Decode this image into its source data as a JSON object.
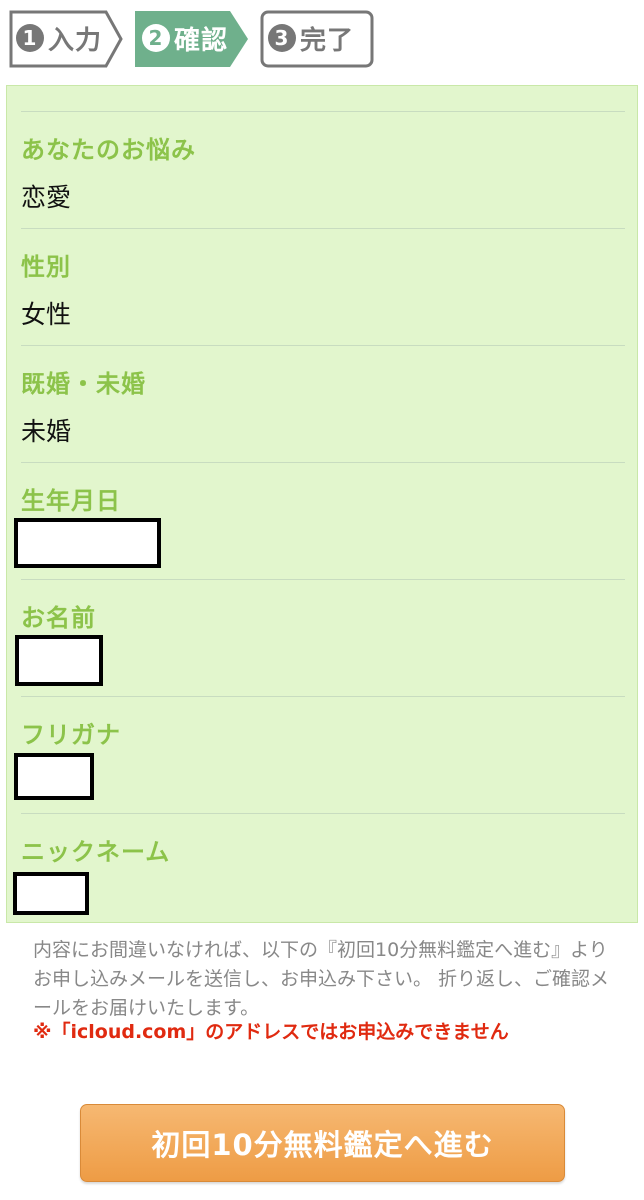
{
  "steps": [
    {
      "num": "1",
      "label": "入力",
      "state": "inactive"
    },
    {
      "num": "2",
      "label": "確認",
      "state": "active"
    },
    {
      "num": "3",
      "label": "完了",
      "state": "inactive"
    }
  ],
  "colors": {
    "step_active": "#6fb08c",
    "step_inactive": "#777777",
    "panel_bg": "#e2f6cd",
    "label": "#8cc34a",
    "warning": "#e02a10",
    "button": "#f0a552"
  },
  "fields": [
    {
      "label": "あなたのお悩み",
      "value": "恋愛"
    },
    {
      "label": "性別",
      "value": "女性"
    },
    {
      "label": "既婚・未婚",
      "value": "未婚"
    },
    {
      "label": "生年月日",
      "value": ""
    },
    {
      "label": "お名前",
      "value": ""
    },
    {
      "label": "フリガナ",
      "value": ""
    },
    {
      "label": "ニックネーム",
      "value": ""
    }
  ],
  "notice": "内容にお間違いなければ、以下の『初回10分無料鑑定へ進む』よりお申し込みメールを送信し、お申込み下さい。 折り返し、ご確認メールをお届けいたします。",
  "warning": "※「icloud.com」のアドレスではお申込みできません",
  "submit_label": "初回10分無料鑑定へ進む"
}
